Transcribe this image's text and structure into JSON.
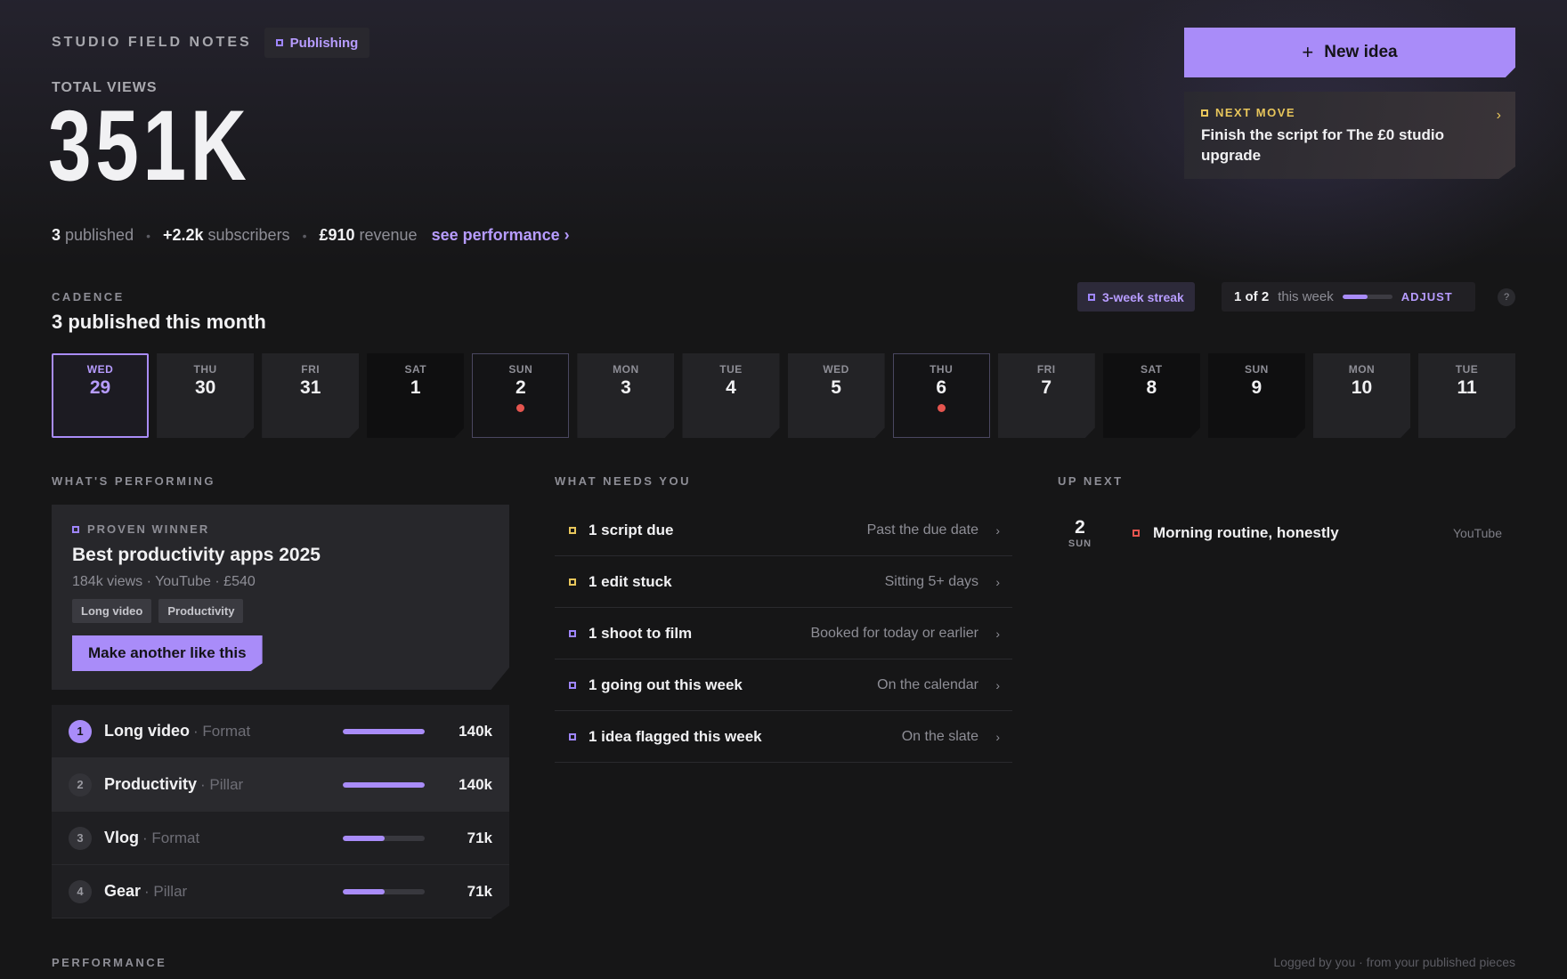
{
  "header": {
    "brand": "STUDIO FIELD NOTES",
    "status_badge": "Publishing",
    "total_label": "TOTAL VIEWS",
    "total_value": "351K",
    "stats": {
      "published_num": "3",
      "published_text": "published",
      "subs_num": "+2.2k",
      "subs_text": "subscribers",
      "revenue_num": "£910",
      "revenue_text": "revenue",
      "link": "see performance ›",
      "separator": "•"
    }
  },
  "actions": {
    "new_idea": "New idea",
    "plus": "+",
    "next_move_label": "NEXT MOVE",
    "next_move_text": "Finish the script for The £0 studio upgrade",
    "chevron": "›"
  },
  "cadence": {
    "label": "CADENCE",
    "title": "3 published this month",
    "streak": "3-week streak",
    "week_count": "1 of 2",
    "week_text": "this week",
    "week_progress": 0.5,
    "adjust": "ADJUST",
    "help": "?",
    "days": [
      {
        "dow": "WED",
        "num": "29",
        "state": "today",
        "mark": false
      },
      {
        "dow": "THU",
        "num": "30",
        "state": "normal",
        "mark": false
      },
      {
        "dow": "FRI",
        "num": "31",
        "state": "normal",
        "mark": false
      },
      {
        "dow": "SAT",
        "num": "1",
        "state": "dark",
        "mark": false
      },
      {
        "dow": "SUN",
        "num": "2",
        "state": "outlined",
        "mark": true
      },
      {
        "dow": "MON",
        "num": "3",
        "state": "normal",
        "mark": false
      },
      {
        "dow": "TUE",
        "num": "4",
        "state": "normal",
        "mark": false
      },
      {
        "dow": "WED",
        "num": "5",
        "state": "normal",
        "mark": false
      },
      {
        "dow": "THU",
        "num": "6",
        "state": "outlined",
        "mark": true
      },
      {
        "dow": "FRI",
        "num": "7",
        "state": "normal",
        "mark": false
      },
      {
        "dow": "SAT",
        "num": "8",
        "state": "dark",
        "mark": false
      },
      {
        "dow": "SUN",
        "num": "9",
        "state": "dark",
        "mark": false
      },
      {
        "dow": "MON",
        "num": "10",
        "state": "normal",
        "mark": false
      },
      {
        "dow": "TUE",
        "num": "11",
        "state": "normal",
        "mark": false
      }
    ]
  },
  "performing": {
    "label": "WHAT'S PERFORMING",
    "winner_label": "PROVEN WINNER",
    "winner_title": "Best productivity apps 2025",
    "winner_meta": "184k views · YouTube · £540",
    "tags": [
      "Long video",
      "Productivity"
    ],
    "cta": "Make another like this",
    "ranks": [
      {
        "n": "1",
        "label": "Long video",
        "sub": "· Format",
        "value": "140k",
        "fill": 1.0
      },
      {
        "n": "2",
        "label": "Productivity",
        "sub": "· Pillar",
        "value": "140k",
        "fill": 1.0
      },
      {
        "n": "3",
        "label": "Vlog",
        "sub": "· Format",
        "value": "71k",
        "fill": 0.51
      },
      {
        "n": "4",
        "label": "Gear",
        "sub": "· Pillar",
        "value": "71k",
        "fill": 0.51
      }
    ]
  },
  "needs": {
    "label": "WHAT NEEDS YOU",
    "items": [
      {
        "title": "1 script due",
        "detail": "Past the due date",
        "color": "yellow"
      },
      {
        "title": "1 edit stuck",
        "detail": "Sitting 5+ days",
        "color": "yellow"
      },
      {
        "title": "1 shoot to film",
        "detail": "Booked for today or earlier",
        "color": "purple"
      },
      {
        "title": "1 going out this week",
        "detail": "On the calendar",
        "color": "purple"
      },
      {
        "title": "1 idea flagged this week",
        "detail": "On the slate",
        "color": "purple"
      }
    ]
  },
  "upnext": {
    "label": "UP NEXT",
    "day_num": "2",
    "day_dow": "SUN",
    "title": "Morning routine, honestly",
    "platform": "YouTube"
  },
  "footer": {
    "performance_label": "PERFORMANCE",
    "note": "Logged by you · from your published pieces"
  },
  "colors": {
    "accent": "#a98cf9",
    "accent_text": "#b79cff",
    "warning": "#e8c65b",
    "alert": "#e5554f",
    "background": "#161617"
  }
}
